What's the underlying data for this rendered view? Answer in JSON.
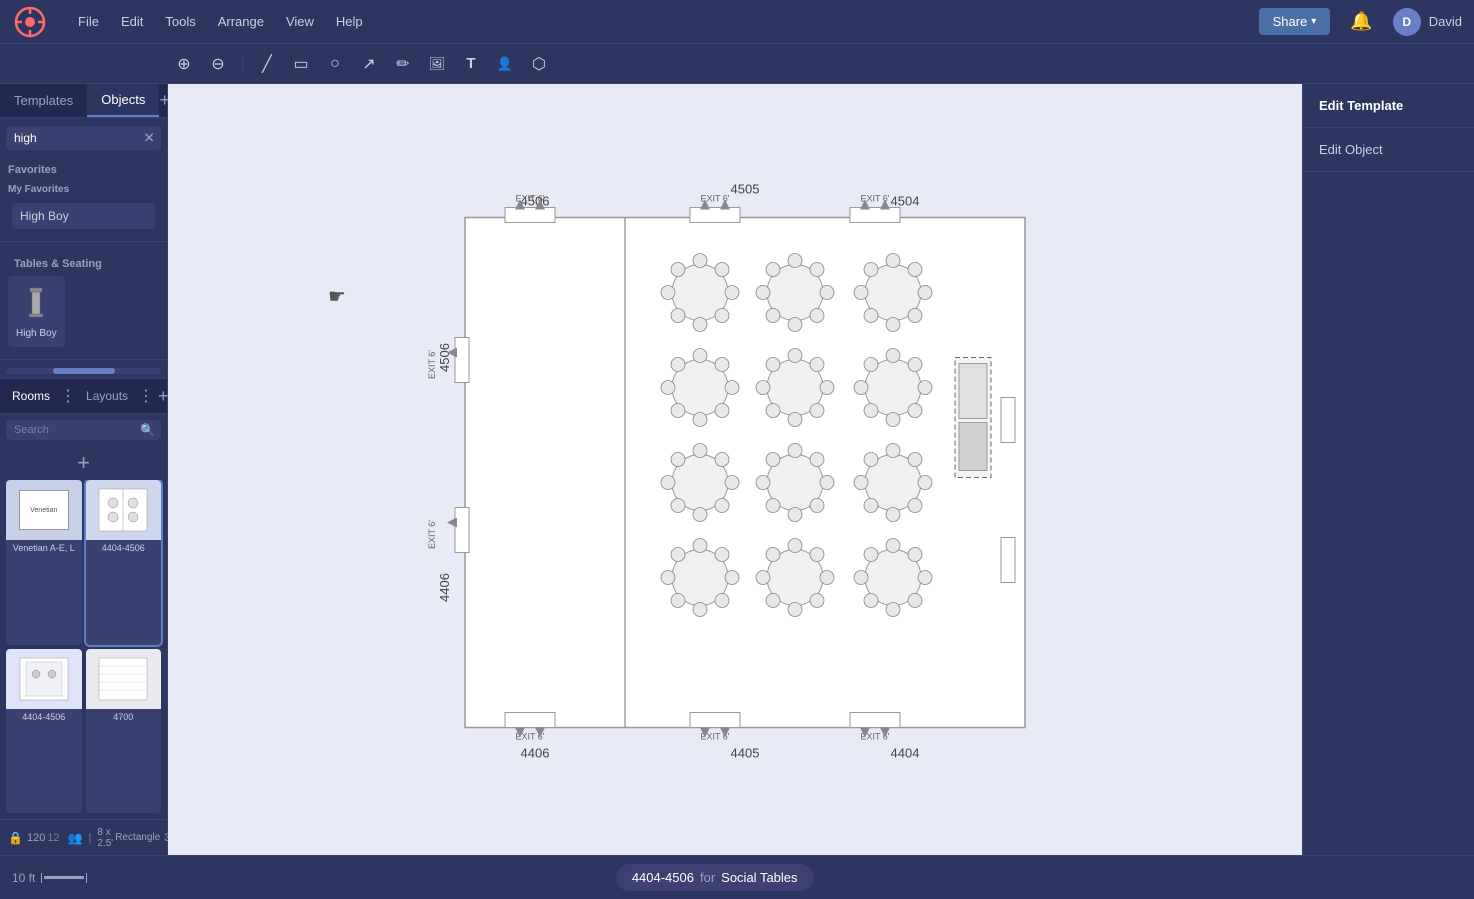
{
  "app": {
    "logo_alt": "Event planning app logo"
  },
  "menubar": {
    "menu_items": [
      "File",
      "Edit",
      "Tools",
      "Arrange",
      "View",
      "Help"
    ],
    "share_label": "Share",
    "user_name": "David",
    "notification_icon": "bell"
  },
  "toolbar": {
    "tools": [
      {
        "name": "zoom-in",
        "symbol": "+",
        "label": "Zoom In"
      },
      {
        "name": "zoom-out",
        "symbol": "−",
        "label": "Zoom Out"
      },
      {
        "name": "separator"
      },
      {
        "name": "line-tool",
        "symbol": "/",
        "label": "Line"
      },
      {
        "name": "rect-tool",
        "symbol": "▭",
        "label": "Rectangle"
      },
      {
        "name": "ellipse-tool",
        "symbol": "●",
        "label": "Ellipse"
      },
      {
        "name": "arrow-tool",
        "symbol": "→",
        "label": "Arrow"
      },
      {
        "name": "pen-tool",
        "symbol": "✏",
        "label": "Pen"
      },
      {
        "name": "image-tool",
        "symbol": "🖼",
        "label": "Image"
      },
      {
        "name": "text-tool",
        "symbol": "T",
        "label": "Text"
      },
      {
        "name": "person-tool",
        "symbol": "👤",
        "label": "Person"
      },
      {
        "name": "shape-tool",
        "symbol": "⬟",
        "label": "Shape"
      }
    ]
  },
  "left_panel": {
    "tabs": [
      "Templates",
      "Objects"
    ],
    "active_tab": "Objects",
    "add_tab_label": "+",
    "search_placeholder": "high",
    "search_value": "high",
    "favorites_section": "Favorites",
    "my_favorites": "My Favorites",
    "high_boy_label": "High Boy",
    "tables_section": "Tables & Seating",
    "high_boy_object_label": "High Boy"
  },
  "rooms_layouts": {
    "rooms_label": "Rooms",
    "layouts_label": "Layouts",
    "search_placeholder": "Search",
    "add_label": "+",
    "layouts": [
      {
        "id": "venetian",
        "label": "Venetian A-E, L"
      },
      {
        "id": "4404-4506",
        "label": "4404-4506",
        "selected": true
      },
      {
        "id": "4404-4506-b",
        "label": "4404-4506"
      },
      {
        "id": "4700",
        "label": "4700"
      }
    ]
  },
  "status_bar": {
    "floor_label": "10 ft",
    "count1": "120",
    "count2": "12",
    "rect_label": "8 x 2.5'",
    "rect_sub": "Rectangle",
    "rect_count": "3"
  },
  "canvas": {
    "room_label": "4404-4506",
    "for_text": "for",
    "social_tables": "Social Tables",
    "exits": [
      {
        "id": "top-left",
        "label": "EXIT 6'"
      },
      {
        "id": "top-center",
        "label": "EXIT 6'"
      },
      {
        "id": "top-right",
        "label": "EXIT 6'"
      },
      {
        "id": "bottom-left",
        "label": "EXIT 6'"
      },
      {
        "id": "bottom-center",
        "label": "EXIT 6'"
      },
      {
        "id": "bottom-right",
        "label": "EXIT 6'"
      },
      {
        "id": "left-top",
        "label": "EXIT 6'"
      },
      {
        "id": "left-bottom",
        "label": "EXIT 6'"
      }
    ],
    "room_numbers": {
      "top": [
        "4506",
        "4505",
        "4504"
      ],
      "bottom": [
        "4406",
        "4405",
        "4404"
      ],
      "left": [
        "4506",
        "4406"
      ]
    },
    "tables": [
      {
        "row": 0,
        "col": 0
      },
      {
        "row": 0,
        "col": 1
      },
      {
        "row": 0,
        "col": 2
      },
      {
        "row": 1,
        "col": 0
      },
      {
        "row": 1,
        "col": 1
      },
      {
        "row": 1,
        "col": 2
      },
      {
        "row": 2,
        "col": 0
      },
      {
        "row": 2,
        "col": 1
      },
      {
        "row": 2,
        "col": 2
      },
      {
        "row": 3,
        "col": 0
      },
      {
        "row": 3,
        "col": 1
      },
      {
        "row": 3,
        "col": 2
      }
    ]
  },
  "right_panel": {
    "items": [
      "Edit Template",
      "Edit Object"
    ]
  },
  "bottom_bar": {
    "scale": "10 ft",
    "room_id": "4404-4506",
    "for_label": "for",
    "venue": "Social Tables"
  }
}
